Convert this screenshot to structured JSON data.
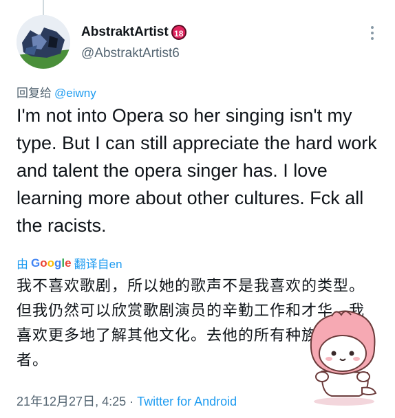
{
  "tweet": {
    "display_name": "AbstraktArtist",
    "badge": "18",
    "handle": "@AbstraktArtist6",
    "reply_prefix": "回复给",
    "reply_to": "@eiwny",
    "text": "I'm not into Opera so her singing isn't my type. But I can still appreciate the hard work and talent the opera singer has. I love learning more about other cultures. Fck all the racists.",
    "translate_prefix": "由",
    "translate_provider": "Google",
    "translate_suffix": "翻译自en",
    "translated_text": "我不喜欢歌剧，所以她的歌声不是我喜欢的类型。但我仍然可以欣赏歌剧演员的辛勤工作和才华。我喜欢更多地了解其他文化。去他的所有种族主义者。",
    "timestamp": "21年12月27日, 4:25",
    "separator": " · ",
    "source": "Twitter for Android"
  },
  "icons": {
    "more": "more-vertical-icon",
    "badge": "age-18-badge-icon",
    "avatar": "avatar-image",
    "sticker": "cartoon-sticker"
  },
  "colors": {
    "link": "#1d9bf0",
    "secondary_text": "#536471",
    "primary_text": "#0f1419",
    "badge": "#e0245e"
  }
}
